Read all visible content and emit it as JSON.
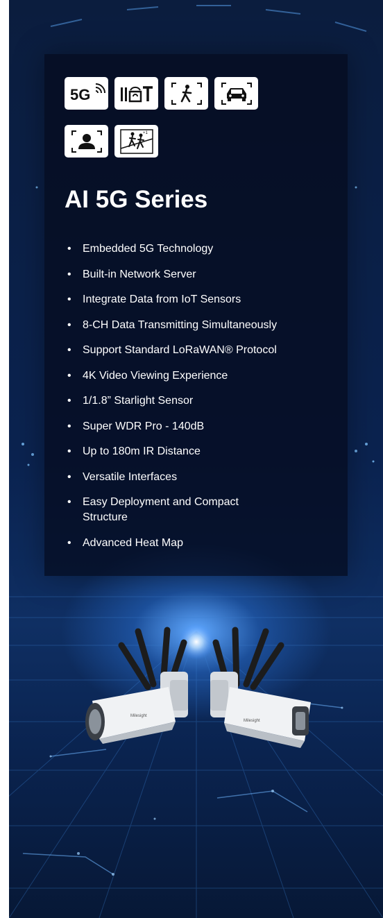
{
  "banner": {
    "icons": [
      {
        "name": "5g-icon",
        "label": "5G"
      },
      {
        "name": "lorawan-iot-icon",
        "label": "IoT"
      },
      {
        "name": "person-detection-icon"
      },
      {
        "name": "vehicle-detection-icon"
      },
      {
        "name": "face-detection-icon"
      },
      {
        "name": "people-counting-icon"
      }
    ],
    "title": "AI 5G Series",
    "features": [
      "Embedded 5G Technology",
      "Built-in Network Server",
      "Integrate Data from IoT Sensors",
      "8-CH Data Transmitting Simultaneously",
      "Support Standard LoRaWAN® Protocol",
      "4K Video Viewing Experience",
      "1/1.8” Starlight Sensor",
      "Super WDR Pro - 140dB",
      "Up to 180m IR Distance",
      "Versatile Interfaces",
      "Easy Deployment and Compact Structure",
      "Advanced Heat Map"
    ],
    "colors": {
      "background": "#0b2350",
      "panel": "#040a1c",
      "accent": "#5fa8ff",
      "text": "#ffffff"
    }
  }
}
